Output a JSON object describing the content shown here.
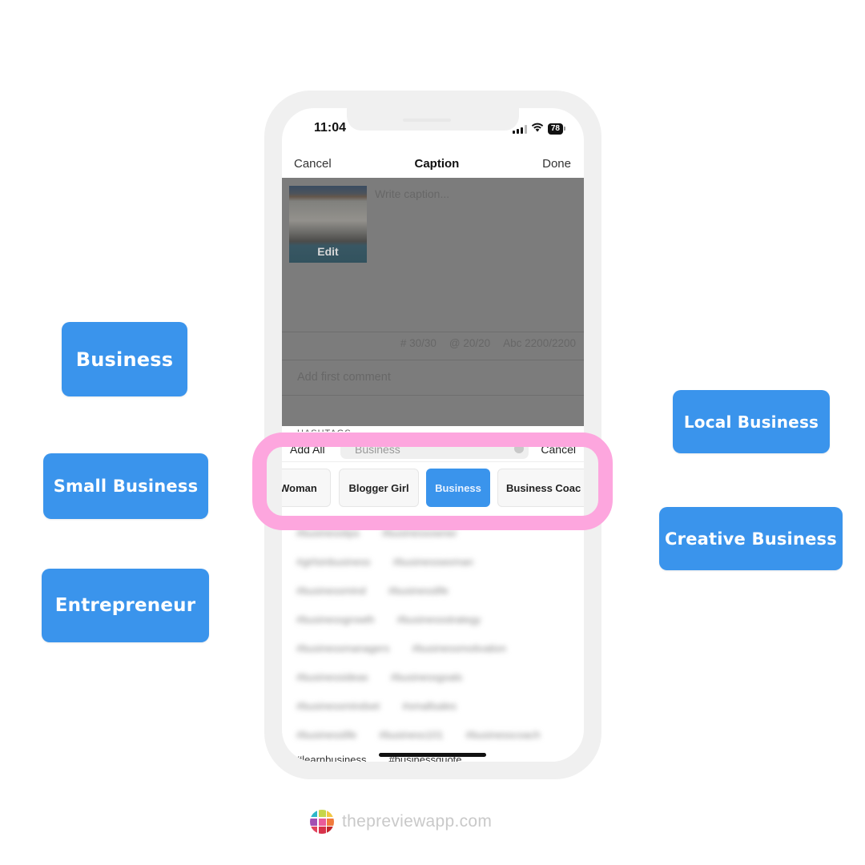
{
  "keywords": [
    {
      "label": "Business"
    },
    {
      "label": "Small Business"
    },
    {
      "label": "Entrepreneur"
    },
    {
      "label": "Local Business"
    },
    {
      "label": "Creative Business"
    }
  ],
  "colors": {
    "accent": "#3a94ec",
    "highlight": "#fda6de",
    "frame": "#f0f0f0",
    "dim_overlay": "#7c7c7c"
  },
  "status_bar": {
    "time": "11:04",
    "battery": "78",
    "icons": [
      "signal-icon",
      "wifi-icon",
      "battery-icon"
    ]
  },
  "nav": {
    "cancel": "Cancel",
    "title": "Caption",
    "done": "Done"
  },
  "post": {
    "thumbnail_edit": "Edit",
    "caption_placeholder": "Write caption...",
    "counters": {
      "hashtags": "# 30/30",
      "mentions": "@ 20/20",
      "characters": "Abc 2200/2200"
    },
    "first_comment_placeholder": "Add first comment",
    "section_label": "HASHTAGS"
  },
  "search": {
    "left_label": "Add All",
    "query": "Business",
    "cancel": "Cancel"
  },
  "categories": [
    {
      "label": "Woman",
      "active": false
    },
    {
      "label": "Blogger Girl",
      "active": false
    },
    {
      "label": "Business",
      "active": true
    },
    {
      "label": "Business Coac",
      "active": false
    }
  ],
  "hashtags_blurred": [
    [
      "#businesstips",
      "#businessowner"
    ],
    [
      "#girlsinbusiness",
      "#businesswoman"
    ],
    [
      "#businessmind",
      "#businesslife"
    ],
    [
      "#businessgrowth",
      "#businessstrategy"
    ],
    [
      "#businessmanagers",
      "#businessmotivation"
    ],
    [
      "#businessideas",
      "#businessgoals"
    ],
    [
      "#businessmindset",
      "#smallsales"
    ],
    [
      "#businesslife",
      "#business101",
      "#businesscoach"
    ]
  ],
  "hashtags_visible": [
    "#learnbusiness",
    "#businessquote"
  ],
  "footer": {
    "brand": "thepreviewapp.com",
    "logo_colors": [
      "#2db7c8",
      "#c6d64a",
      "#f2c744",
      "#a24fb3",
      "#ea5b9a",
      "#f07a3c",
      "#e2435e",
      "#d8314a",
      "#c1272d"
    ]
  }
}
